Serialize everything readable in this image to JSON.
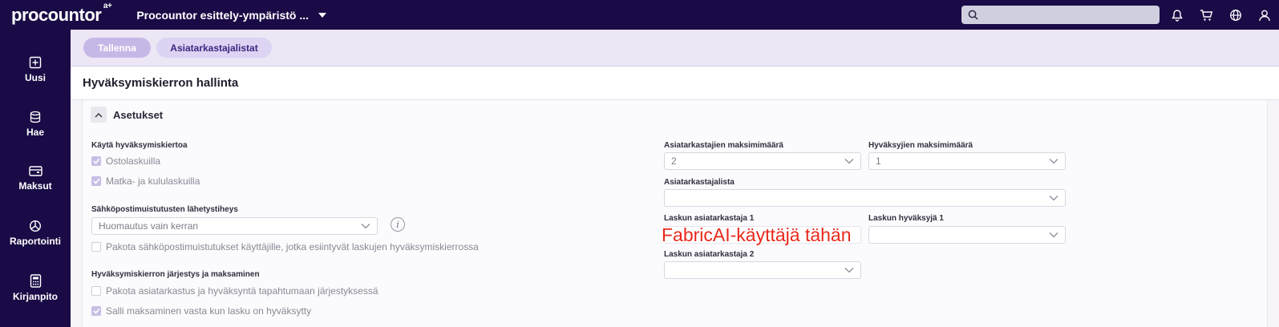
{
  "app": {
    "logo": "procountor",
    "logo_sup": "a+",
    "environment": "Procountor esittely-ympäristö ..."
  },
  "search": {
    "placeholder": ""
  },
  "sidebar": {
    "items": [
      {
        "label": "Uusi",
        "icon": "plus-square-icon"
      },
      {
        "label": "Hae",
        "icon": "database-icon"
      },
      {
        "label": "Maksut",
        "icon": "wallet-icon"
      },
      {
        "label": "Raportointi",
        "icon": "pie-chart-icon"
      },
      {
        "label": "Kirjanpito",
        "icon": "calculator-icon"
      }
    ]
  },
  "toolbar": {
    "save_label": "Tallenna",
    "lists_label": "Asiatarkastajalistat"
  },
  "page": {
    "title": "Hyväksymiskierron hallinta",
    "section_title": "Asetukset"
  },
  "left": {
    "use_cycle_label": "Käytä hyväksymiskiertoa",
    "cb_purchase": "Ostolaskuilla",
    "cb_travel": "Matka- ja kululaskuilla",
    "email_freq_label": "Sähköpostimuistutusten lähetystiheys",
    "email_freq_value": "Huomautus vain kerran",
    "cb_force_email": "Pakota sähköpostimuistutukset käyttäjille, jotka esiintyvät laskujen hyväksymiskierrossa",
    "order_label": "Hyväksymiskierron järjestys ja maksaminen",
    "cb_force_order": "Pakota asiatarkastus ja hyväksyntä tapahtumaan järjestyksessä",
    "cb_allow_pay": "Salli maksaminen vasta kun lasku on hyväksytty"
  },
  "right": {
    "max_reviewers_label": "Asiatarkastajien maksimimäärä",
    "max_reviewers_value": "2",
    "max_approvers_label": "Hyväksyjien maksimimäärä",
    "max_approvers_value": "1",
    "reviewer_list_label": "Asiatarkastajalista",
    "reviewer_list_value": "",
    "reviewer1_label": "Laskun asiatarkastaja 1",
    "reviewer1_annotation": "FabricAI-käyttäjä tähän",
    "approver1_label": "Laskun hyväksyjä 1",
    "approver1_value": "",
    "reviewer2_label": "Laskun asiatarkastaja 2",
    "reviewer2_value": ""
  },
  "colors": {
    "brand_dark": "#1a0b46",
    "toolbar_bg": "#ece6f5",
    "annotation_red": "#e8291c"
  }
}
